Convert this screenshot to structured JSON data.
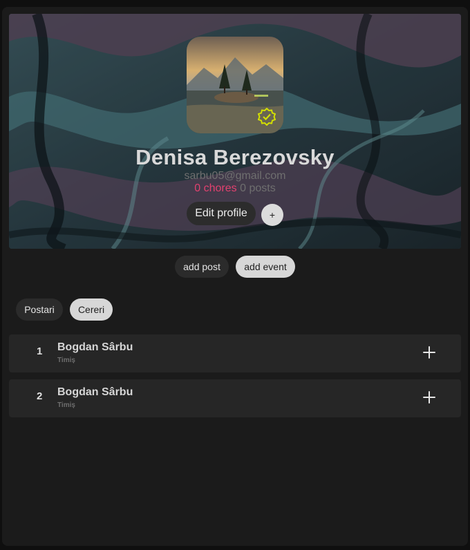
{
  "profile": {
    "name": "Denisa Berezovsky",
    "email": "sarbu05@gmail.com",
    "chores": "0 chores",
    "posts": "0 posts",
    "edit_label": "Edit profile",
    "plus_label": "+",
    "verified_icon": "verified-badge-icon"
  },
  "actions": {
    "add_post": "add post",
    "add_event": "add event"
  },
  "tabs": [
    {
      "label": "Postari",
      "active": false
    },
    {
      "label": "Cereri",
      "active": true
    }
  ],
  "requests": [
    {
      "index": "1",
      "name": "Bogdan Sârbu",
      "location": "Timiș"
    },
    {
      "index": "2",
      "name": "Bogdan Sârbu",
      "location": "Timiș"
    }
  ],
  "colors": {
    "background": "#1b1b1b",
    "chores_accent": "#e2416f",
    "verified": "#d4e000"
  }
}
